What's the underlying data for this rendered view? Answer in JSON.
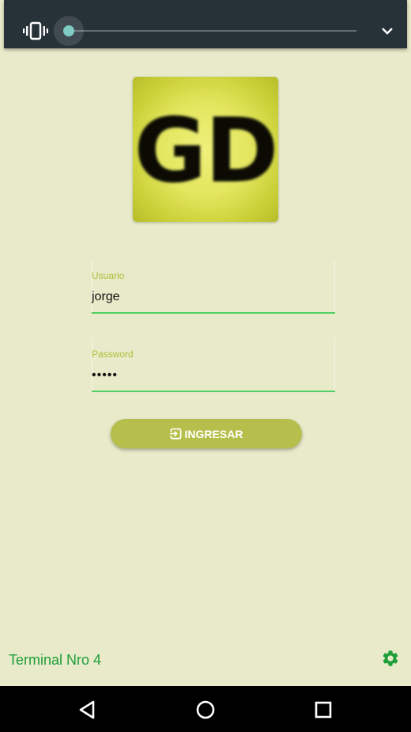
{
  "volume_panel": {
    "vibrate_icon": "vibrate-icon",
    "slider_level": 0.0,
    "collapse_icon": "chevron-down-icon"
  },
  "logo": {
    "text": "GD"
  },
  "form": {
    "username": {
      "label": "Usuario",
      "value": "jorge"
    },
    "password": {
      "label": "Password",
      "value": "•••••"
    },
    "login_button": {
      "label": "INGRESAR",
      "icon": "login-icon"
    }
  },
  "footer": {
    "terminal_label": "Terminal Nro 4",
    "settings_icon": "gear-icon"
  },
  "nav_bar": {
    "back_icon": "back-triangle-icon",
    "home_icon": "home-circle-icon",
    "recents_icon": "recents-square-icon"
  },
  "colors": {
    "background": "#e8eac9",
    "accent": "#b6bf4b",
    "field_underline": "#4fd064",
    "label": "#a8c23a",
    "terminal_text": "#1f9e3a",
    "panel": "#263238",
    "slider_thumb": "#80cbc4"
  }
}
